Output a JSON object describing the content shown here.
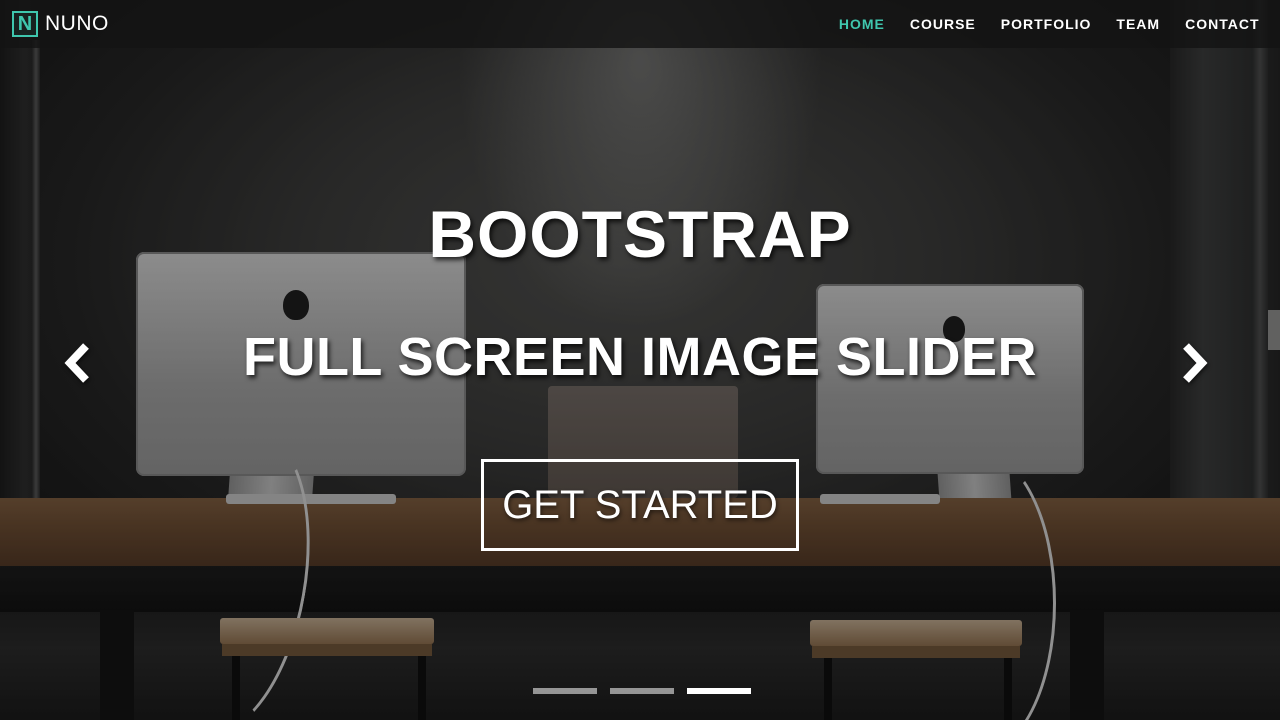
{
  "brand": {
    "icon_letter": "N",
    "name": "NUNO",
    "accent_color": "#3fc7ae"
  },
  "nav": {
    "items": [
      {
        "label": "HOME",
        "active": true
      },
      {
        "label": "COURSE",
        "active": false
      },
      {
        "label": "PORTFOLIO",
        "active": false
      },
      {
        "label": "TEAM",
        "active": false
      },
      {
        "label": "CONTACT",
        "active": false
      }
    ]
  },
  "hero": {
    "title": "BOOTSTRAP",
    "subtitle": "FULL SCREEN IMAGE SLIDER",
    "cta_label": "GET STARTED"
  },
  "carousel": {
    "prev_icon": "chevron-left-icon",
    "next_icon": "chevron-right-icon",
    "slide_count": 3,
    "active_slide_index": 2
  }
}
